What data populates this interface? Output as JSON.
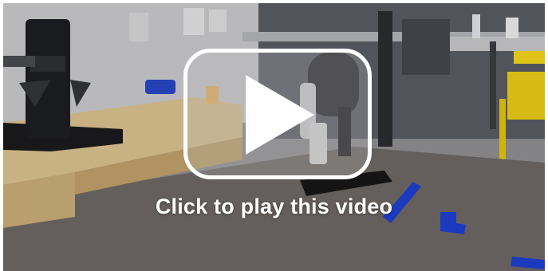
{
  "video": {
    "caption": "Click to play this video",
    "play_icon": "play-icon",
    "state": "paused"
  },
  "colors": {
    "overlay_border": "#ffffff",
    "caption_text": "#ffffff",
    "tape": "#1f3fd0",
    "table_surface": "#6d6864",
    "chair": "#f2d41c"
  }
}
